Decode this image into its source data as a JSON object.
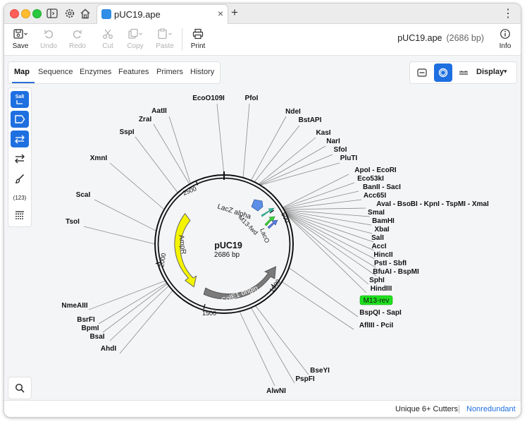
{
  "tab": {
    "title": "pUC19.ape",
    "close": "×",
    "new": "+"
  },
  "toolbar": {
    "save": "Save",
    "undo": "Undo",
    "redo": "Redo",
    "cut": "Cut",
    "copy": "Copy",
    "paste": "Paste",
    "print": "Print",
    "info": "Info",
    "doc_name": "pUC19.ape",
    "doc_length": "(2686 bp)"
  },
  "view_tabs": [
    "Map",
    "Sequence",
    "Enzymes",
    "Features",
    "Primers",
    "History"
  ],
  "display": {
    "label": "Display"
  },
  "sidebar": {
    "sali": "SalI",
    "count": "(123)"
  },
  "plasmid": {
    "name": "pUC19",
    "length": "2686 bp"
  },
  "ticks": [
    "500",
    "1000",
    "1500",
    "2000",
    "2500"
  ],
  "features": {
    "lacz": "LacZ alpha",
    "m13fwd": "M13-fwd",
    "laco": "LacO",
    "ampr": "AmpR",
    "ori": "ColE1 origin",
    "m13rev": "M13-rev"
  },
  "enzymes": [
    "EcoO109I",
    "PfoI",
    "NdeI",
    "BstAPI",
    "AatII",
    "ZraI",
    "KasI",
    "NarI",
    "SfoI",
    "PluTI",
    "SspI",
    "XmnI",
    "ApoI - EcoRI",
    "Eco53kI",
    "BanII - SacI",
    "Acc65I",
    "AvaI - BsoBI - KpnI - TspMI - XmaI",
    "ScaI",
    "SmaI",
    "BamHI",
    "TsoI",
    "XbaI",
    "SalI",
    "AccI",
    "HincII",
    "PstI - SbfI",
    "BfuAI - BspMI",
    "SphI",
    "HindIII",
    "BspQI - SapI",
    "NmeAIII",
    "AflIII - PciI",
    "BsrFI",
    "BpmI",
    "BsaI",
    "AhdI",
    "BseYI",
    "PspFI",
    "AlwNI"
  ],
  "status": {
    "cutters": "Unique 6+ Cutters",
    "mode": "Nonredundant"
  }
}
